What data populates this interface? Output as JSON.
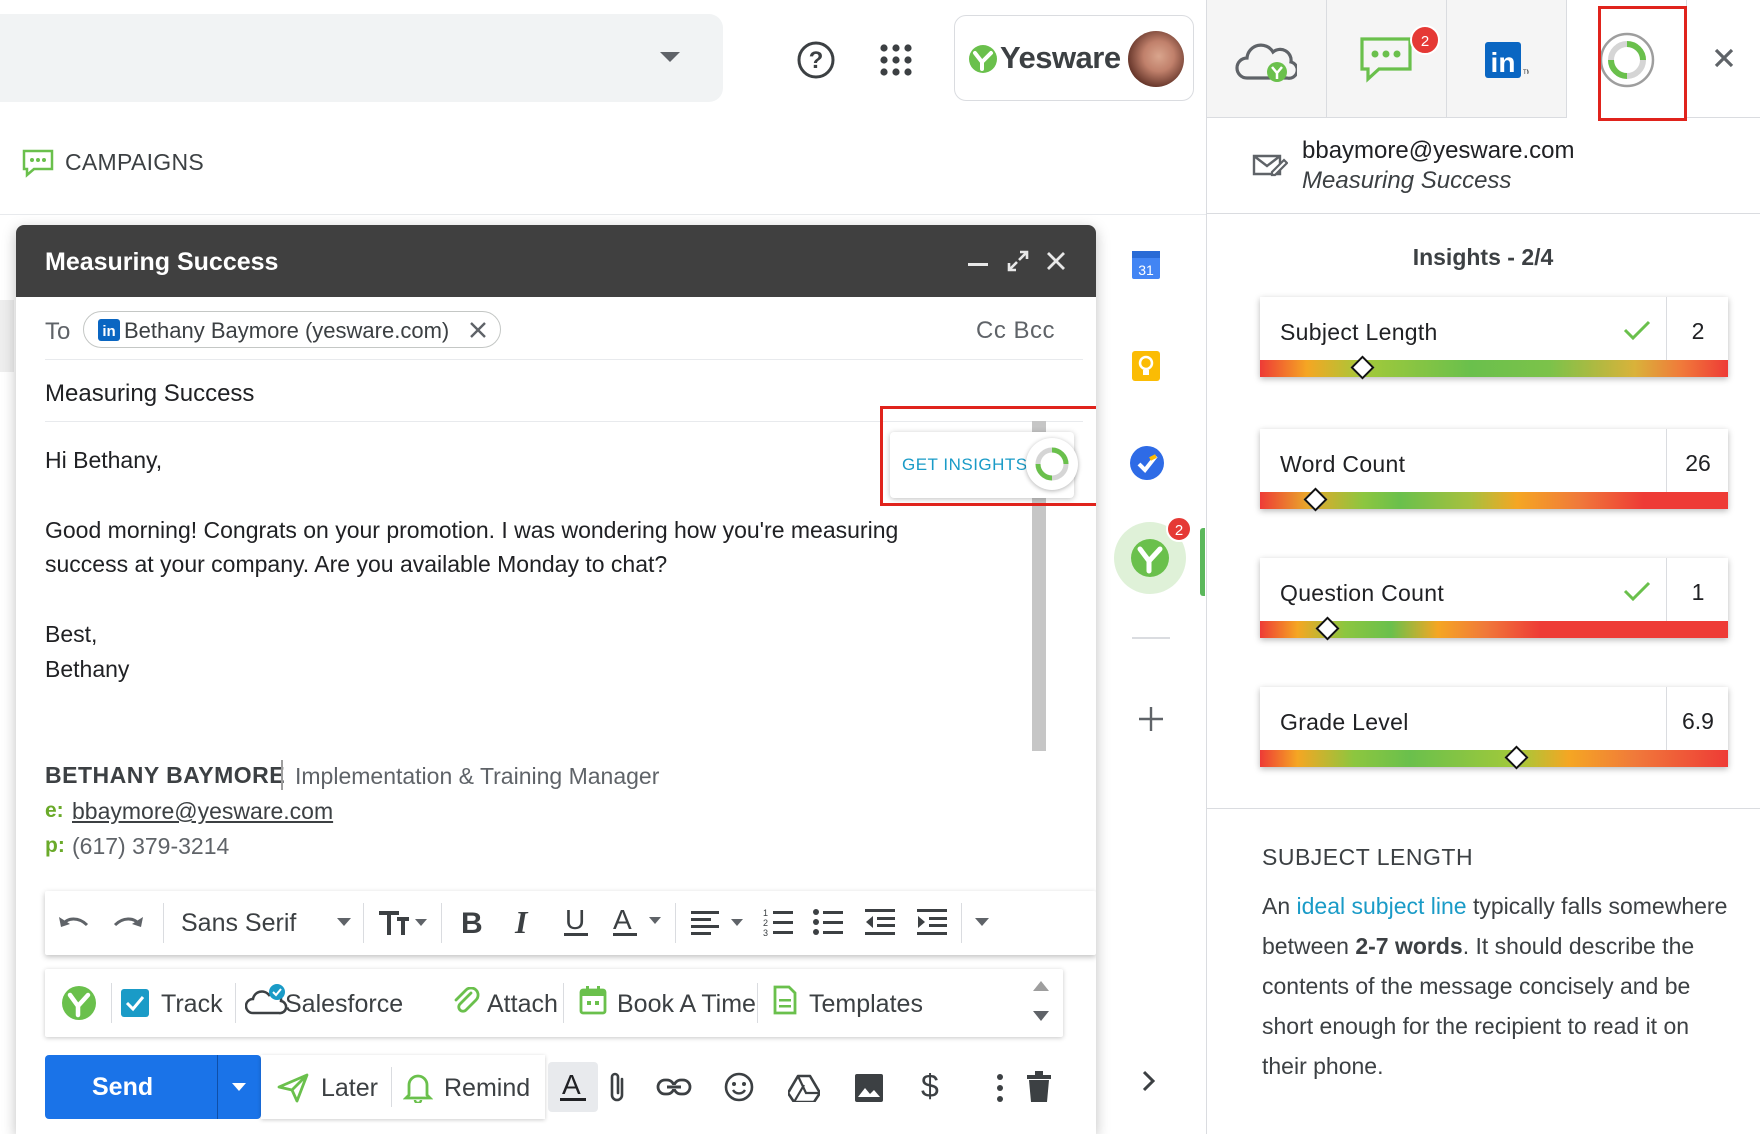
{
  "brand": {
    "name": "Yesware",
    "accent": "#6ac04c",
    "link": "#1a9bc7",
    "primary": "#1a73e8",
    "highlight": "#e0231c"
  },
  "topbar": {
    "icons": [
      "help-icon",
      "apps-grid-icon",
      "search-caret-icon"
    ],
    "logo_text": "Yesware"
  },
  "campaigns": {
    "label": "CAMPAIGNS",
    "icon": "chat-bubble-icon"
  },
  "compose": {
    "title": "Measuring Success",
    "to_label": "To",
    "recipient": "Bethany Baymore (yesware.com)",
    "cc_bcc": "Cc Bcc",
    "subject": "Measuring Success",
    "body": {
      "greeting": "Hi Bethany,",
      "line1": "Good morning!  Congrats on your promotion.  I was wondering how you're measuring",
      "line2": "success at your company.  Are you available Monday to chat?",
      "closing": "Best,",
      "name": "Bethany"
    },
    "get_insights": "GET INSIGHTS",
    "signature": {
      "name": "BETHANY BAYMORE",
      "title": "Implementation & Training Manager",
      "email_key": "e:",
      "email": "bbaymore@yesware.com",
      "phone_key": "p:",
      "phone": "(617) 379-3214"
    },
    "format_toolbar": {
      "font": "Sans Serif"
    },
    "yesware_toolbar": {
      "track": "Track",
      "salesforce": "Salesforce",
      "attach": "Attach",
      "book": "Book A Time",
      "templates": "Templates"
    },
    "send": "Send",
    "later": "Later",
    "remind": "Remind"
  },
  "rail": {
    "calendar_day": "31",
    "yesware_badge": "2"
  },
  "sidebar": {
    "tab_badge": "2",
    "linkedin_text": "in",
    "contact_email": "bbaymore@yesware.com",
    "contact_subject": "Measuring Success",
    "insights_heading": "Insights - 2/4",
    "metrics": [
      {
        "label": "Subject Length",
        "value": "2",
        "passing": true,
        "marker_position": 0.22
      },
      {
        "label": "Word Count",
        "value": "26",
        "passing": false,
        "marker_position": 0.12
      },
      {
        "label": "Question Count",
        "value": "1",
        "passing": true,
        "marker_position": 0.145
      },
      {
        "label": "Grade Level",
        "value": "6.9",
        "passing": false,
        "marker_position": 0.55
      }
    ],
    "detail": {
      "heading": "SUBJECT LENGTH",
      "pre_link": "An ",
      "link": "ideal subject line",
      "post_link": " typically falls somewhere between ",
      "bold": "2-7 words",
      "rest": ". It should describe the contents of the message concisely and be short enough for the recipient to read it on their phone."
    }
  }
}
